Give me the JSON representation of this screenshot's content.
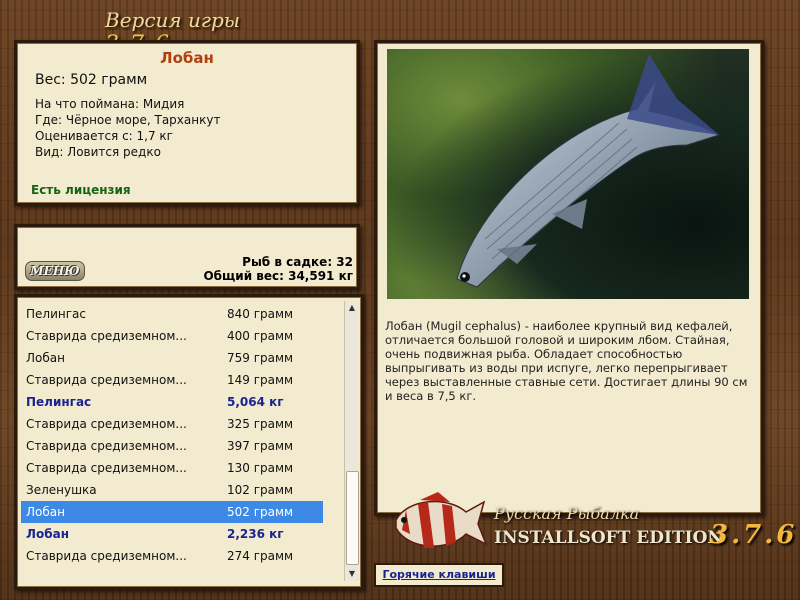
{
  "header": {
    "title_prefix": "Версия игры",
    "title_version": "3.7.6"
  },
  "fish": {
    "name": "Лобан",
    "weight": "Вес: 502 грамм",
    "caught_on": "На что поймана: Мидия",
    "where": "Где: Чёрное море, Тарханкут",
    "value": "Оценивается с: 1,7 кг",
    "kind": "Вид: Ловится редко",
    "license": "Есть лицензия",
    "description": "Лобан (Mugil cephalus) - наиболее крупный вид кефалей, отличается большой головой и широким лбом. Стайная, очень подвижная рыба. Обладает способностью выпрыгивать из воды при испуге, легко перепрыгивает через выставленные ставные сети. Достигает длины 90 см и веса в 7,5 кг."
  },
  "menu": {
    "label": "МЕНЮ"
  },
  "stats": {
    "fish_in_keepnet": "Рыб в садке: 32",
    "total_weight": "Общий вес: 34,591 кг"
  },
  "catch_list": [
    {
      "name": "Пелингас",
      "weight": "840 грамм",
      "bold": false,
      "selected": false
    },
    {
      "name": "Ставрида средиземном...",
      "weight": "400 грамм",
      "bold": false,
      "selected": false
    },
    {
      "name": "Лобан",
      "weight": "759 грамм",
      "bold": false,
      "selected": false
    },
    {
      "name": "Ставрида средиземном...",
      "weight": "149 грамм",
      "bold": false,
      "selected": false
    },
    {
      "name": "Пелингас",
      "weight": "5,064 кг",
      "bold": true,
      "selected": false
    },
    {
      "name": "Ставрида средиземном...",
      "weight": "325 грамм",
      "bold": false,
      "selected": false
    },
    {
      "name": "Ставрида средиземном...",
      "weight": "397 грамм",
      "bold": false,
      "selected": false
    },
    {
      "name": "Ставрида средиземном...",
      "weight": "130 грамм",
      "bold": false,
      "selected": false
    },
    {
      "name": "Зеленушка",
      "weight": "102 грамм",
      "bold": false,
      "selected": false
    },
    {
      "name": "Лобан",
      "weight": "502 грамм",
      "bold": false,
      "selected": true
    },
    {
      "name": "Лобан",
      "weight": "2,236 кг",
      "bold": true,
      "selected": false
    },
    {
      "name": "Ставрида средиземном...",
      "weight": "274 грамм",
      "bold": false,
      "selected": false
    }
  ],
  "logo": {
    "line1": "Русская Рыбалка",
    "line2": "INSTALLSOFT EDITION",
    "version": "3.7.6"
  },
  "footer": {
    "hotkeys_label": "Горячие клавиши"
  }
}
